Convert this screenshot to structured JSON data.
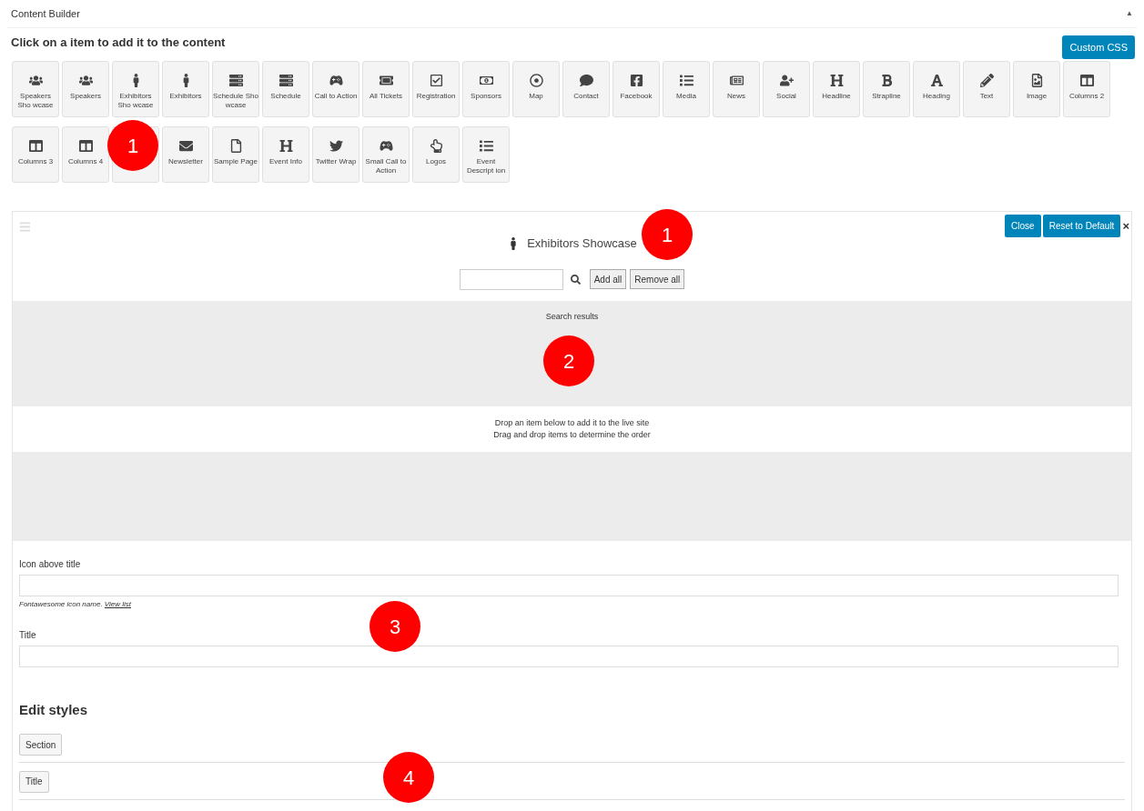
{
  "header": {
    "title": "Content Builder",
    "collapse_icon": "▲"
  },
  "palette": {
    "heading": "Click on a item to add it to the content",
    "custom_css_button": "Custom CSS",
    "rows": [
      [
        {
          "kind": "item",
          "label": "Speakers Sho wcase"
        },
        {
          "kind": "item",
          "label": "Speakers"
        },
        {
          "kind": "item",
          "label": "Exhibitors Sho wcase"
        },
        {
          "kind": "item",
          "label": "Exhibitors"
        },
        {
          "kind": "item",
          "label": "Schedule Sho wcase"
        },
        {
          "kind": "item",
          "label": "Schedule"
        },
        {
          "kind": "item",
          "label": "Call to Action"
        },
        {
          "kind": "item",
          "label": "All Tickets"
        },
        {
          "kind": "item",
          "label": "Registration"
        },
        {
          "kind": "item",
          "label": "Sponsors"
        },
        {
          "kind": "item",
          "label": "Map"
        },
        {
          "kind": "item",
          "label": "Contact"
        },
        {
          "kind": "item",
          "label": "Facebook"
        },
        {
          "kind": "item",
          "label": "Media"
        },
        {
          "kind": "item",
          "label": "News"
        },
        {
          "kind": "item",
          "label": "Social"
        },
        {
          "kind": "item",
          "label": "Headline"
        },
        {
          "kind": "item",
          "label": "Strapline"
        },
        {
          "kind": "item",
          "label": "Heading"
        },
        {
          "kind": "item",
          "label": "Text"
        },
        {
          "kind": "item",
          "label": "Image"
        },
        {
          "kind": "item",
          "label": "Columns 2"
        }
      ],
      [
        {
          "kind": "item",
          "label": "Columns 3"
        },
        {
          "kind": "item",
          "label": "Columns 4"
        },
        {
          "kind": "covered"
        },
        {
          "kind": "item",
          "label": "Newsletter"
        },
        {
          "kind": "item",
          "label": "Sample Page"
        },
        {
          "kind": "item",
          "label": "Event Info"
        },
        {
          "kind": "item",
          "label": "Twitter Wrap"
        },
        {
          "kind": "item",
          "label": "Small Call to Action"
        },
        {
          "kind": "item",
          "label": "Logos"
        },
        {
          "kind": "item",
          "label": "Event Descript ion"
        }
      ]
    ]
  },
  "editor": {
    "title": "Exhibitors Showcase",
    "close_button": "Close",
    "reset_button": "Reset to Default",
    "dismiss": "×",
    "add_all_button": "Add all",
    "remove_all_button": "Remove all",
    "search_results_label": "Search results",
    "drop_hint": [
      "Drop an item below to add it to the live site",
      "Drag and drop items to determine the order"
    ],
    "fields": [
      {
        "label": "Icon above title",
        "hint": "Fontawesome icon name. ",
        "hint_link": "View list"
      },
      {
        "label": "Title"
      }
    ],
    "styles_heading": "Edit styles",
    "style_buttons": [
      "Section",
      "Title"
    ]
  },
  "callouts": [
    "1",
    "1",
    "2",
    "3",
    "4"
  ]
}
